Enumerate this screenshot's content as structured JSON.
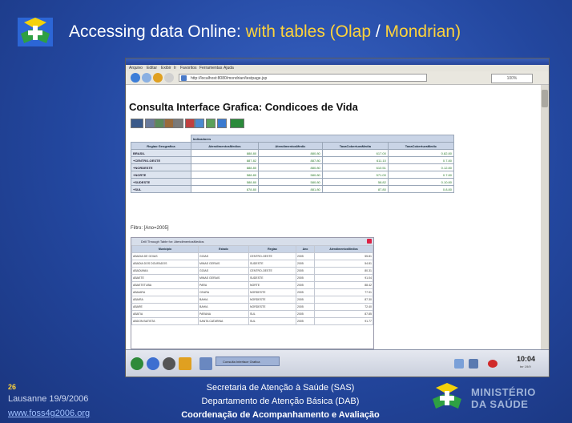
{
  "slide": {
    "title_prefix": "Accessing data Online: ",
    "title_highlight": "with tables (Olap",
    "title_sep": " / ",
    "title_highlight2": "Mondrian)"
  },
  "browser": {
    "menu": [
      "Arquivo",
      "Editar",
      "Exibir",
      "Ir",
      "Favoritos",
      "Ferramentas",
      "Ajuda"
    ],
    "url": "http://localhost:8080/mondrian/testpage.jsp",
    "zoom_field": "100%"
  },
  "page": {
    "heading": "Consulta Interface Grafica: Condicoes de Vida",
    "filter_text": "Filtro: [Ano=2005]",
    "grid": {
      "group_header": "Indicadores",
      "row_header": "Regiao Geografica",
      "columns": [
        "AtendimentosMedios",
        "AtendimentosMedic",
        "TaxaCoberturaMedia",
        "TaxaCoberturaMedic"
      ],
      "rows": [
        {
          "label": "BRASIL",
          "values": [
            "888.80",
            "880.80",
            "617.00",
            "0.82.80"
          ]
        },
        {
          "label": "+CENTRO-OESTE",
          "values": [
            "887.82",
            "887.80",
            "611.10",
            "0.7.80"
          ]
        },
        {
          "label": "+NORDESTE",
          "values": [
            "888.80",
            "880.80",
            "610.51",
            "0.12.80"
          ]
        },
        {
          "label": "+NORTE",
          "values": [
            "588.80",
            "580.80",
            "571.00",
            "0.7.80"
          ]
        },
        {
          "label": "+SUDESTE",
          "values": [
            "588.80",
            "580.80",
            "58.82",
            "0.10.80"
          ]
        },
        {
          "label": "+SUL",
          "values": [
            "878.80",
            "881.80",
            "87.80",
            "0.8.80"
          ]
        }
      ]
    },
    "drill": {
      "title": "Drill Through Table for: AtendimentosMedios",
      "columns": [
        "Municipio",
        "Estado",
        "Regiao",
        "Ano",
        "AtendimentosMedios"
      ],
      "rows": [
        [
          "ABADIA DE GOIAS",
          "GOIAS",
          "CENTRO-OESTE",
          "2005",
          "55.81"
        ],
        [
          "ABADIA DOS DOURADOS",
          "MINAS GERAIS",
          "SUDESTE",
          "2005",
          "54.81"
        ],
        [
          "ABADIANIA",
          "GOIAS",
          "CENTRO-OESTE",
          "2005",
          "80.31"
        ],
        [
          "ABAETE",
          "MINAS GERAIS",
          "SUDESTE",
          "2005",
          "91.04"
        ],
        [
          "ABAETETUBA",
          "PARA",
          "NORTE",
          "2005",
          "88.42"
        ],
        [
          "ABAIARA",
          "CEARA",
          "NORDESTE",
          "2005",
          "77.91"
        ],
        [
          "ABAIRA",
          "BAHIA",
          "NORDESTE",
          "2005",
          "87.30"
        ],
        [
          "ABARE",
          "BAHIA",
          "NORDESTE",
          "2005",
          "72.40"
        ],
        [
          "ABATIA",
          "PARANA",
          "SUL",
          "2005",
          "87.85"
        ],
        [
          "ABDON BATISTA",
          "SANTA CATARINA",
          "SUL",
          "2005",
          "91.77"
        ]
      ]
    }
  },
  "taskbar": {
    "window_label": "Consulta Interface Grafica",
    "clock": "10:04",
    "clock_sub": "ter 19/9"
  },
  "footer": {
    "slide_number": "26",
    "city_date": "Lausanne 19/9/2006",
    "url": "www.foss4g2006.org",
    "line1": "Secretaria de Atenção à Saúde (SAS)",
    "line2": "Departamento de Atenção Básica (DAB)",
    "line3": "Coordenação de Acompanhamento e Avaliação",
    "ministry_line1": "MINISTÉRIO",
    "ministry_line2": "DA SAÚDE"
  },
  "colors": {
    "background": "#23479f",
    "title_highlight": "#ffd33a",
    "link": "#9fc0ff"
  }
}
